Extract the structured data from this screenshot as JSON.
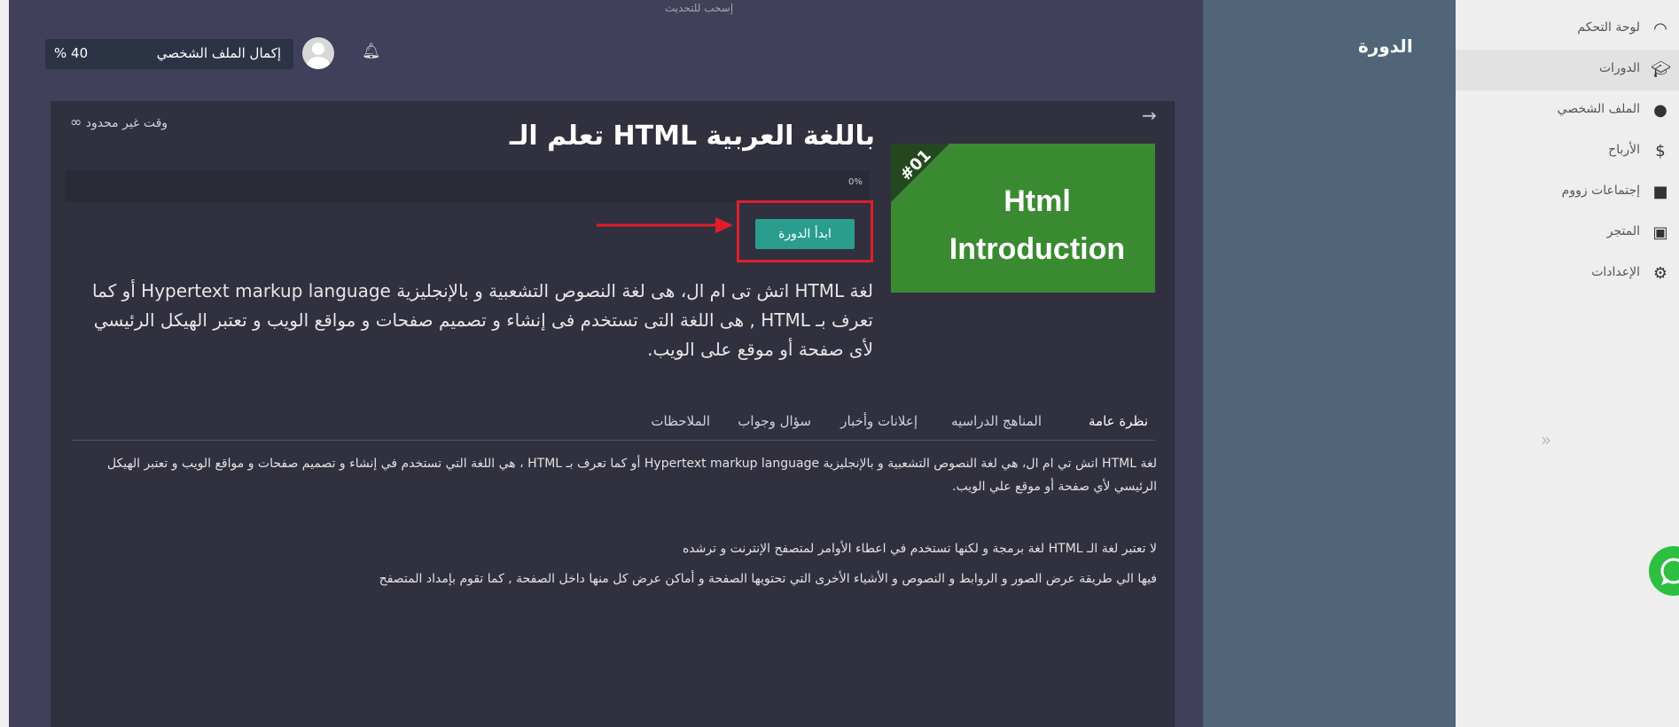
{
  "header": {
    "update_tag": "إسحب للتحديث",
    "profile_completion_label": "إكمال الملف الشخصي",
    "profile_completion_percent": "% 40",
    "page_title": "الدورة"
  },
  "course": {
    "time_limit": "وقت غير محدود",
    "title": "تعلم الـ HTML باللغة العربية",
    "thumbnail_tag": "#01",
    "thumbnail_line1": "Html",
    "thumbnail_line2": "Introduction",
    "progress_text": "0%",
    "progress_value": 0,
    "start_button_label": "ابدأ الدورة",
    "description": "لغة HTML اتش تى ام ال، هى لغة النصوص التشعبية و بالإنجليزية Hypertext markup language أو كما تعرف بـ HTML , هى اللغة التى تستخدم فى إنشاء و تصميم صفحات و مواقع الويب و تعتبر الهيكل الرئيسي لأى صفحة أو موقع على الويب."
  },
  "tabs": [
    {
      "label": "نظرة عامة",
      "active": true
    },
    {
      "label": "المناهج الدراسيه",
      "active": false
    },
    {
      "label": "إعلانات وأخبار",
      "active": false
    },
    {
      "label": "سؤال وجواب",
      "active": false
    },
    {
      "label": "الملاحظات",
      "active": false
    }
  ],
  "overview": {
    "para1": "لغة HTML اتش تي ام ال، هي لغة النصوص التشعبية و بالإنجليزية Hypertext markup language أو كما تعرف بـ HTML ، هي اللغة التي تستخدم في إنشاء و تصميم صفحات و مواقع الويب و تعتبر الهيكل الرئيسي لأي صفحة أو موقع علي الويب.",
    "para2": "لا تعتبر لغة الـ HTML لغة برمجة و لكنها تستخدم في اعطاء الأوامر لمتصفح الإنترنت و ترشده",
    "para3": "فيها الي طريقة عرض الصور و الروابط و النصوص و الأشياء الأخرى التي تحتويها الصفحة و أماكن عرض كل منها داخل الصفحة , كما تقوم بإمداد المتصفح"
  },
  "sidebar": {
    "items": [
      {
        "label": "لوحة التحكم",
        "icon": "gauge-icon",
        "active": false
      },
      {
        "label": "الدورات",
        "icon": "graduation-cap-icon",
        "active": true
      },
      {
        "label": "الملف الشخصي",
        "icon": "user-circle-icon",
        "active": false
      },
      {
        "label": "الأرباح",
        "icon": "dollar-coin-icon",
        "active": false
      },
      {
        "label": "إجتماعات زووم",
        "icon": "video-camera-icon",
        "active": false
      },
      {
        "label": "المتجر",
        "icon": "shopping-bag-icon",
        "active": false
      },
      {
        "label": "الإعدادات",
        "icon": "gear-icon",
        "active": false
      }
    ]
  },
  "colors": {
    "content_bg": "#40405a",
    "card_bg": "#30303f",
    "panel_bg": "#506678",
    "start_button": "#2a9d8f",
    "highlight_border": "#e01e2a",
    "thumbnail_green": "#3a8a32",
    "whatsapp": "#2dbf3f"
  }
}
